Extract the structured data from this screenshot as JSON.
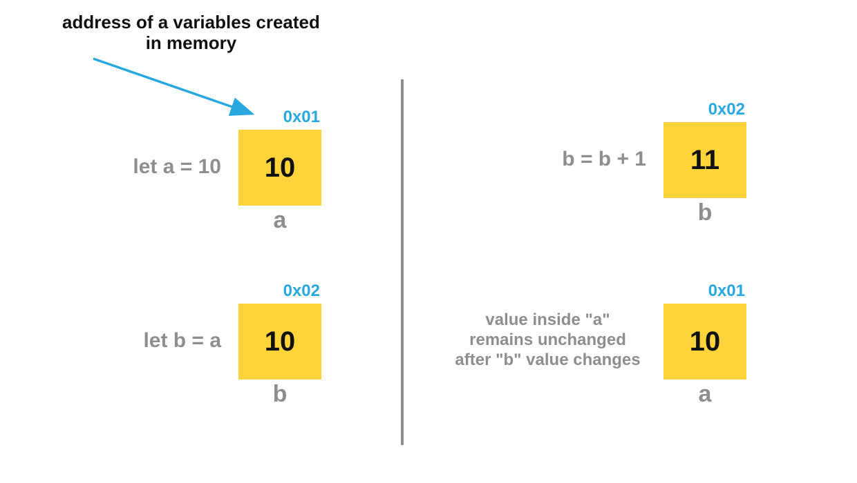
{
  "colors": {
    "box_fill": "#ffd43b",
    "address_text": "#29a8e0",
    "label_text": "#8e8e8e",
    "annotation_text": "#111111",
    "arrow": "#29a8e0",
    "divider": "#8e8e8e"
  },
  "annotation": {
    "text": "address of a variables created\nin memory"
  },
  "left_panel": {
    "cell_a": {
      "address": "0x01",
      "value": "10",
      "var_name": "a",
      "label": "let a = 10"
    },
    "cell_b": {
      "address": "0x02",
      "value": "10",
      "var_name": "b",
      "label": "let b = a"
    }
  },
  "right_panel": {
    "cell_b": {
      "address": "0x02",
      "value": "11",
      "var_name": "b",
      "label": "b = b + 1"
    },
    "cell_a": {
      "address": "0x01",
      "value": "10",
      "var_name": "a",
      "label": "value inside \"a\"\nremains unchanged\nafter \"b\" value changes"
    }
  }
}
